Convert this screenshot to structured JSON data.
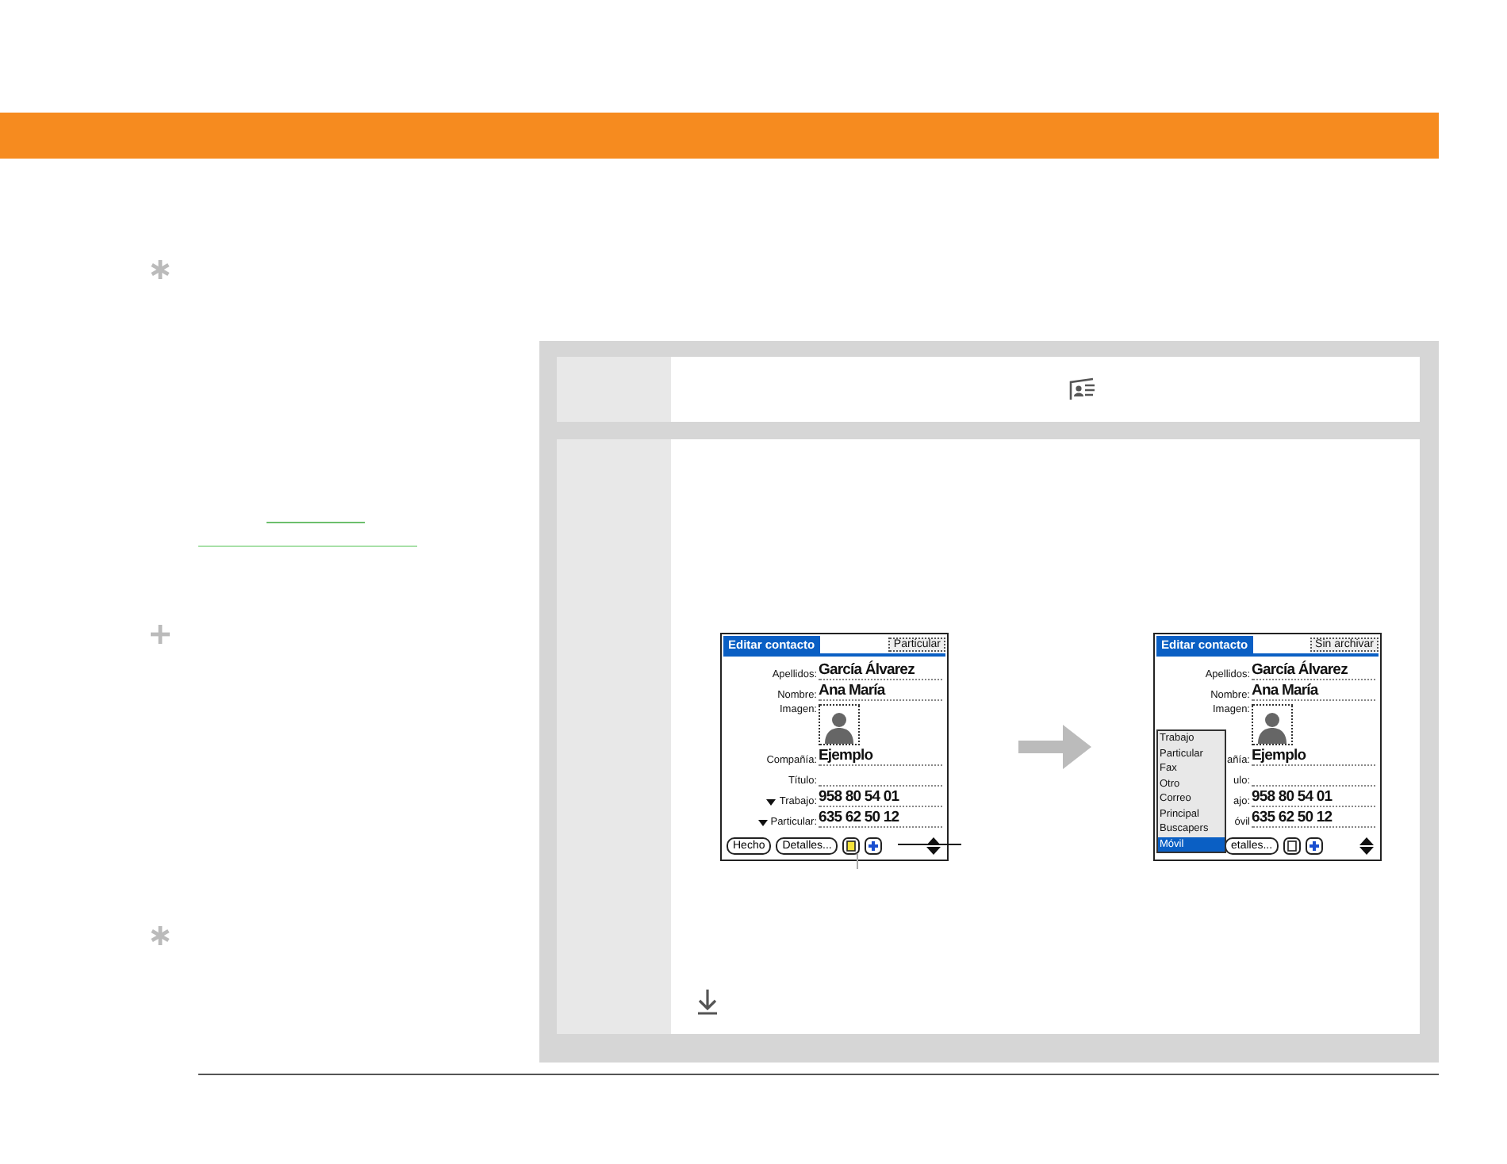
{
  "margin_markers": [
    {
      "kind": "asterisk"
    },
    {
      "kind": "plus"
    },
    {
      "kind": "asterisk"
    }
  ],
  "screens": [
    {
      "title": "Editar contacto",
      "category": "Particular",
      "fields": [
        {
          "kind": "text",
          "label": "Apellidos:",
          "value": "García Álvarez"
        },
        {
          "kind": "text",
          "label": "Nombre:",
          "value": "Ana María"
        },
        {
          "kind": "picture",
          "label": "Imagen:"
        },
        {
          "kind": "text",
          "label": "Compañía:",
          "value": "Ejemplo"
        },
        {
          "kind": "text",
          "label": "Título:"
        },
        {
          "kind": "dropdown",
          "label": "Trabajo:",
          "value": "958 80 54 01"
        },
        {
          "kind": "dropdown",
          "label": "Particular:",
          "value": "635 62 50 12"
        }
      ],
      "buttons": [
        "Hecho",
        "Detalles..."
      ],
      "callouts": true
    },
    {
      "title": "Editar contacto",
      "category": "Sin archivar",
      "fields": [
        {
          "kind": "text",
          "label": "Apellidos:",
          "value": "García Álvarez"
        },
        {
          "kind": "text",
          "label": "Nombre:",
          "value": "Ana María"
        },
        {
          "kind": "picture",
          "label": "Imagen:"
        },
        {
          "kind": "text",
          "label": "añía:",
          "value": "Ejemplo"
        },
        {
          "kind": "text",
          "label": "ulo:"
        },
        {
          "kind": "text",
          "label": "ajo:",
          "value": "958 80 54 01"
        },
        {
          "kind": "text",
          "label": "óvil",
          "value": "635 62 50 12"
        }
      ],
      "buttons": [
        "etalles..."
      ],
      "callouts": false,
      "popup": [
        {
          "label": "Trabajo",
          "selected": false
        },
        {
          "label": "Particular",
          "selected": false
        },
        {
          "label": "Fax",
          "selected": false
        },
        {
          "label": "Otro",
          "selected": false
        },
        {
          "label": "Correo",
          "selected": false
        },
        {
          "label": "Principal",
          "selected": false
        },
        {
          "label": "Buscapers",
          "selected": false
        },
        {
          "label": "Móvil",
          "selected": true
        }
      ]
    }
  ]
}
